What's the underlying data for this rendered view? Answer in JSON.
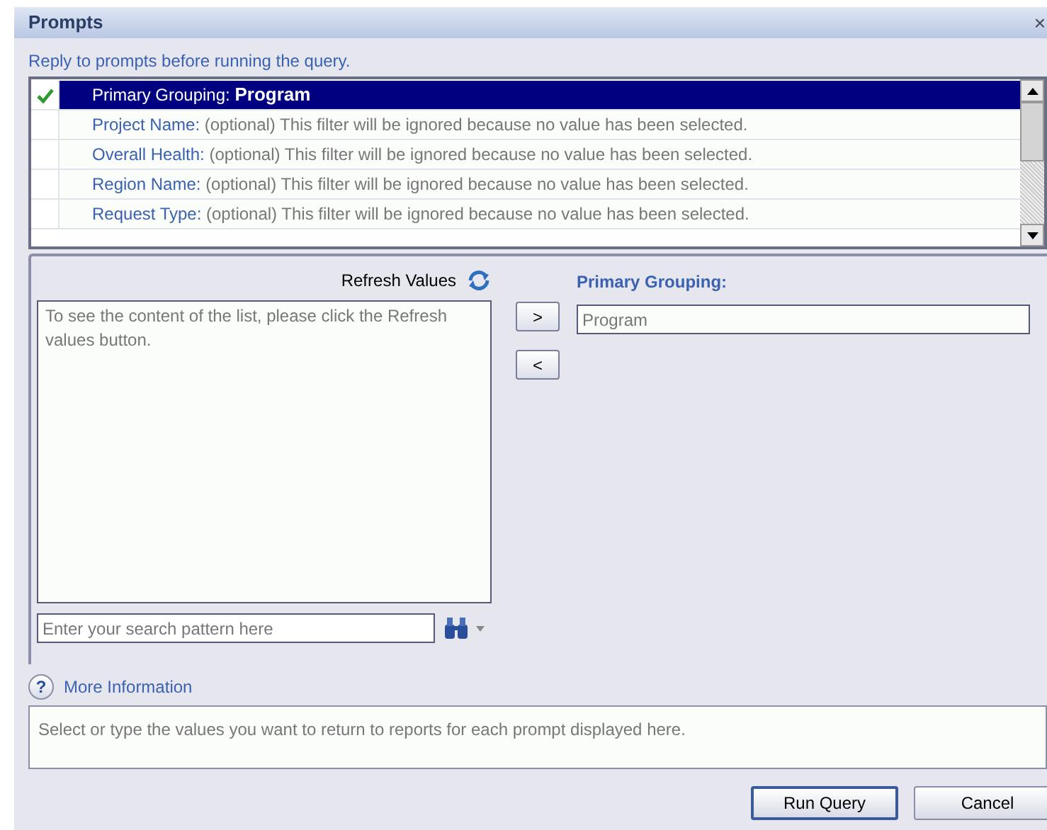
{
  "window": {
    "title": "Prompts",
    "close": "×"
  },
  "instruction": "Reply to prompts before running the query.",
  "prompts": [
    {
      "name": "Primary Grouping:",
      "value": "Program",
      "answered": true,
      "selected": true
    },
    {
      "name": "Project Name:",
      "note": "(optional) This filter will be ignored because no value has been selected.",
      "answered": false,
      "selected": false
    },
    {
      "name": "Overall Health:",
      "note": "(optional) This filter will be ignored because no value has been selected.",
      "answered": false,
      "selected": false
    },
    {
      "name": "Region Name:",
      "note": "(optional) This filter will be ignored because no value has been selected.",
      "answered": false,
      "selected": false
    },
    {
      "name": "Request Type:",
      "note": "(optional) This filter will be ignored because no value has been selected.",
      "answered": false,
      "selected": false
    }
  ],
  "refresh_label": "Refresh Values",
  "values_list": {
    "message": "To see the content of the list, please click the Refresh values button."
  },
  "search": {
    "placeholder": "Enter your search pattern here"
  },
  "move_buttons": [
    ">",
    "<"
  ],
  "selection": {
    "label": "Primary Grouping:",
    "value": "Program"
  },
  "more_information": "More Information",
  "help_icon": "?",
  "description": "Select or type the values you want to return to reports for each prompt displayed here.",
  "buttons": [
    {
      "label": "Run Query",
      "default": true
    },
    {
      "label": "Cancel",
      "default": false
    }
  ]
}
